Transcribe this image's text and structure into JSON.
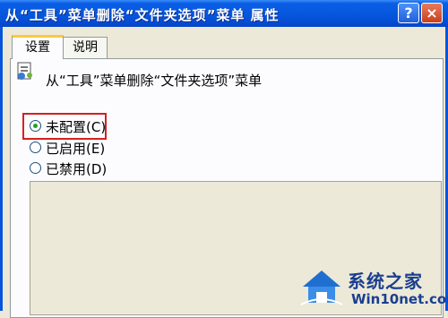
{
  "window": {
    "title": "从“工具”菜单删除“文件夹选项”菜单 属性",
    "help_symbol": "?",
    "close_symbol": "×"
  },
  "tabs": [
    {
      "label": "设置",
      "active": true
    },
    {
      "label": "说明",
      "active": false
    }
  ],
  "policy": {
    "name": "从“工具”菜单删除“文件夹选项”菜单",
    "icon": "policy-setting-icon"
  },
  "options": [
    {
      "label": "未配置(C)",
      "selected": true
    },
    {
      "label": "已启用(E)",
      "selected": false
    },
    {
      "label": "已禁用(D)",
      "selected": false
    }
  ],
  "watermark": {
    "line1": "系统之家",
    "line2": "Win10net.com"
  },
  "colors": {
    "titlebar": "#0655dc",
    "highlight": "#d62020",
    "radio_dot": "#21a121",
    "dialog_bg": "#ece9d8"
  }
}
